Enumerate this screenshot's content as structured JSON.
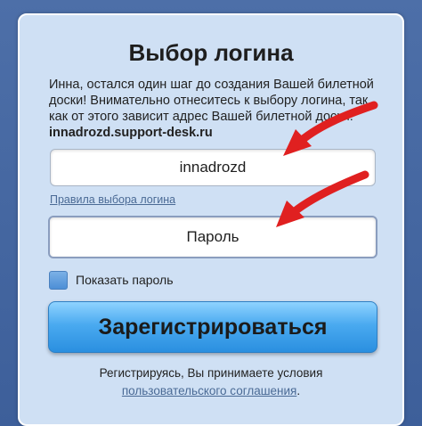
{
  "form": {
    "title": "Выбор логина",
    "intro_text": "Инна, остался один шаг до создания Вашей билетной доски! Внимательно отнеситесь к выбору логина, так как от этого зависит адрес Вашей билетной доски:",
    "board_address": "innadrozd.support-desk.ru",
    "login_value": "innadrozd",
    "rules_link": "Правила выбора логина",
    "password_placeholder": "Пароль",
    "show_password_label": "Показать пароль",
    "register_button": "Зарегистрироваться",
    "terms_text": "Регистрируясь, Вы принимаете условия",
    "terms_link": "пользовательского соглашения",
    "terms_end": "."
  },
  "colors": {
    "background": "#4d6fa8",
    "card": "#cfe0f4",
    "button": "#4aaaf0",
    "arrow": "#e02020",
    "link": "#4a6a95"
  }
}
